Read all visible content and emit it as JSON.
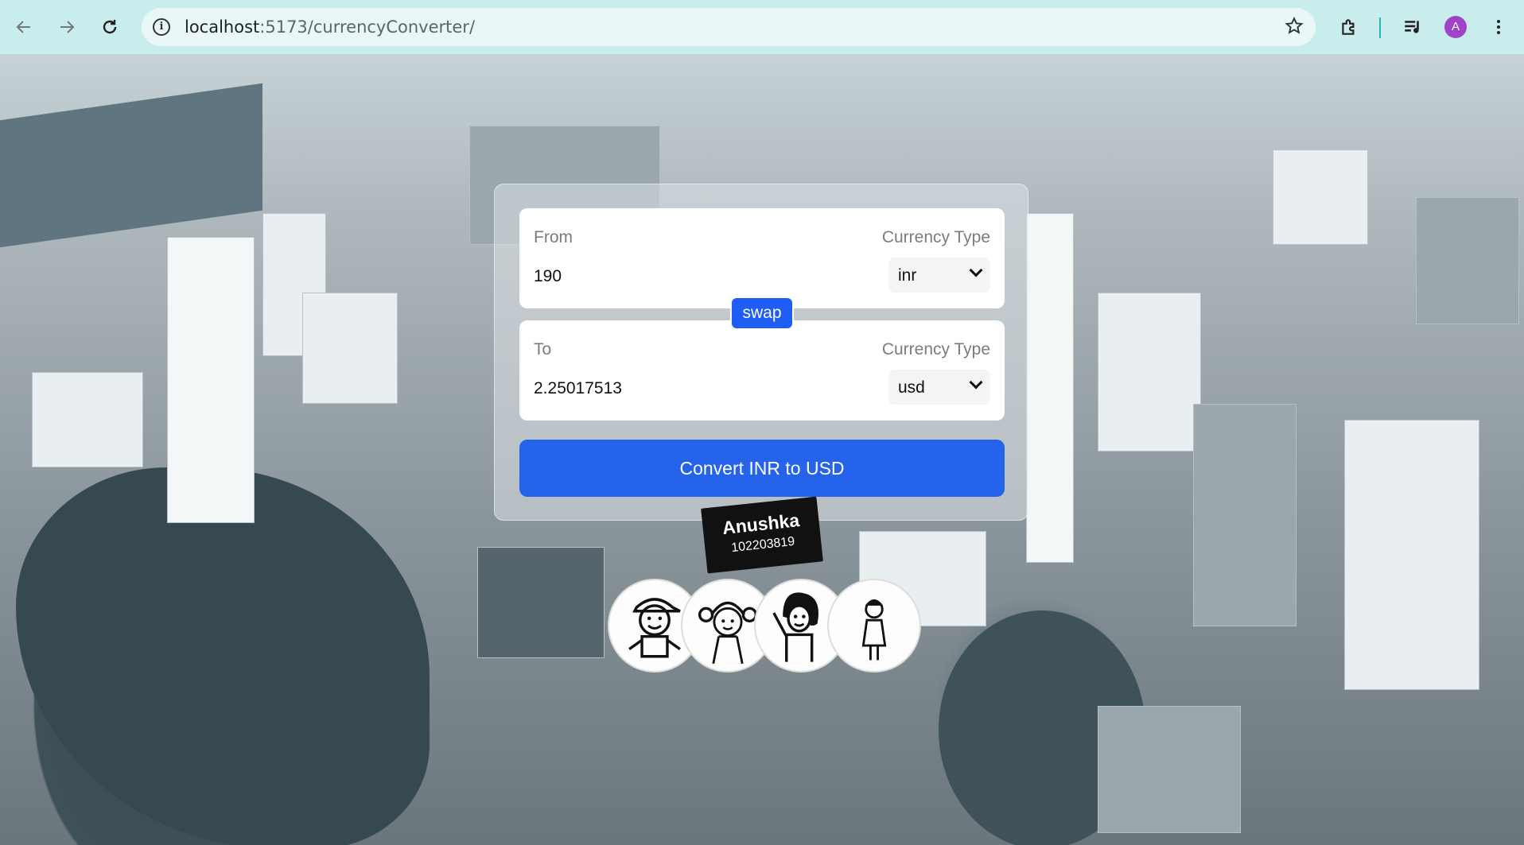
{
  "browser": {
    "url_host": "localhost",
    "url_path": ":5173/currencyConverter/",
    "profile_initial": "A",
    "icons": [
      "back-arrow-icon",
      "forward-arrow-icon",
      "reload-icon",
      "site-info-icon",
      "bookmark-star-icon",
      "extensions-icon",
      "media-control-icon",
      "more-vert-icon"
    ]
  },
  "converter": {
    "from": {
      "label": "From",
      "currency_type_label": "Currency Type",
      "amount": "190",
      "currency": "inr"
    },
    "swap_label": "swap",
    "to": {
      "label": "To",
      "currency_type_label": "Currency Type",
      "amount": "2.25017513",
      "currency": "usd"
    },
    "convert_label": "Convert INR to USD",
    "accent_color": "#2563eb"
  },
  "author": {
    "name": "Anushka",
    "id": "102203819"
  }
}
